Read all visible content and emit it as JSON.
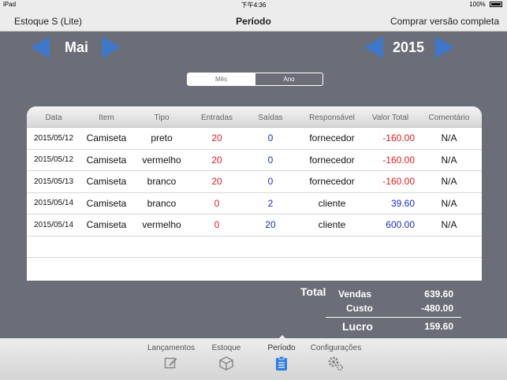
{
  "statusbar": {
    "device": "iPad",
    "time": "下午4:36",
    "battery": "100%"
  },
  "navbar": {
    "left": "Estoque S (Lite)",
    "title": "Período",
    "right": "Comprar versão completa"
  },
  "selectors": {
    "month": "Mai",
    "year": "2015"
  },
  "segment": {
    "month_label": "Mês",
    "year_label": "Ano",
    "selected": "Mês"
  },
  "table": {
    "headers": [
      "Data",
      "Item",
      "Tipo",
      "Entradas",
      "Saídas",
      "Responsável",
      "Valor Total",
      "Comentário"
    ],
    "rows": [
      {
        "date": "2015/05/12",
        "item": "Camiseta",
        "tipo": "preto",
        "entradas": "20",
        "saidas": "0",
        "responsavel": "fornecedor",
        "valor": "-160.00",
        "comentario": "N/A"
      },
      {
        "date": "2015/05/12",
        "item": "Camiseta",
        "tipo": "vermelho",
        "entradas": "20",
        "saidas": "0",
        "responsavel": "fornecedor",
        "valor": "-160.00",
        "comentario": "N/A"
      },
      {
        "date": "2015/05/13",
        "item": "Camiseta",
        "tipo": "branco",
        "entradas": "20",
        "saidas": "0",
        "responsavel": "fornecedor",
        "valor": "-160.00",
        "comentario": "N/A"
      },
      {
        "date": "2015/05/14",
        "item": "Camiseta",
        "tipo": "branco",
        "entradas": "0",
        "saidas": "2",
        "responsavel": "cliente",
        "valor": "39.60",
        "comentario": "N/A"
      },
      {
        "date": "2015/05/14",
        "item": "Camiseta",
        "tipo": "vermelho",
        "entradas": "0",
        "saidas": "20",
        "responsavel": "cliente",
        "valor": "600.00",
        "comentario": "N/A"
      }
    ]
  },
  "totals": {
    "label": "Total",
    "vendas_label": "Vendas",
    "vendas": "639.60",
    "custo_label": "Custo",
    "custo": "-480.00",
    "lucro_label": "Lucro",
    "lucro": "159.60"
  },
  "tabbar": {
    "items": [
      {
        "label": "Lançamentos",
        "icon": "edit-icon"
      },
      {
        "label": "Estoque",
        "icon": "box-icon"
      },
      {
        "label": "Período",
        "icon": "clipboard-icon"
      },
      {
        "label": "Configurações",
        "icon": "gears-icon"
      }
    ],
    "active": "Período"
  },
  "colors": {
    "accent": "#3f78c8",
    "negative": "#e02020",
    "positive": "#1a2ec8",
    "background": "#6b6e78"
  }
}
